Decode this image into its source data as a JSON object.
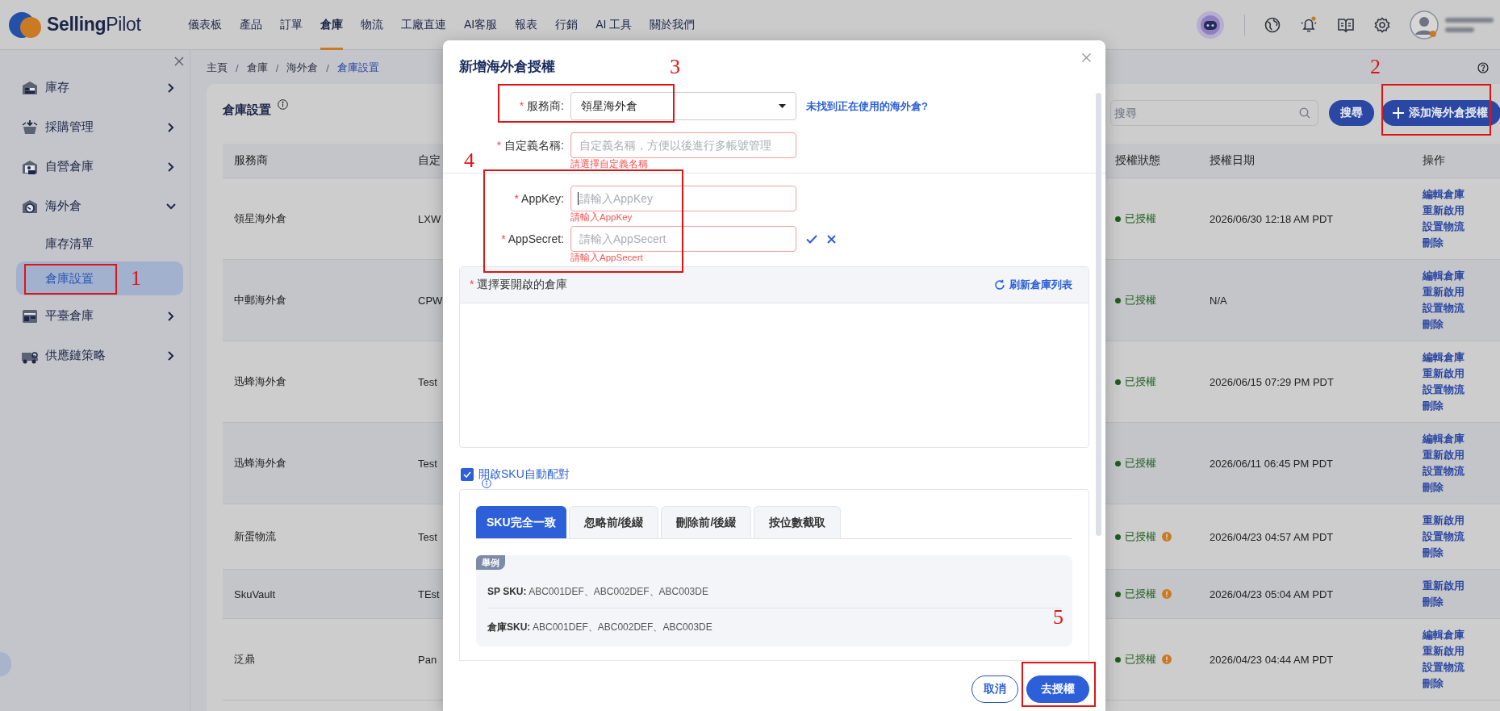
{
  "nav": {
    "logo": "**Selling**Pilot",
    "items": [
      {
        "label": "儀表板",
        "selected": false
      },
      {
        "label": "產品",
        "selected": false
      },
      {
        "label": "訂單",
        "selected": false
      },
      {
        "label": "倉庫",
        "selected": true
      },
      {
        "label": "物流",
        "selected": false
      },
      {
        "label": "工廠直連",
        "selected": false
      },
      {
        "label": "AI客服",
        "selected": false
      },
      {
        "label": "報表",
        "selected": false
      },
      {
        "label": "行銷",
        "selected": false
      },
      {
        "label": "AI 工具",
        "selected": false
      },
      {
        "label": "關於我們",
        "selected": false
      }
    ]
  },
  "sidebar": {
    "items": [
      {
        "label": "庫存",
        "expanded": false
      },
      {
        "label": "採購管理",
        "expanded": false
      },
      {
        "label": "自營倉庫",
        "expanded": false
      },
      {
        "label": "海外倉",
        "expanded": true,
        "children": [
          {
            "label": "庫存清單",
            "selected": false
          },
          {
            "label": "倉庫設置",
            "selected": true
          }
        ]
      },
      {
        "label": "平臺倉庫",
        "expanded": false
      },
      {
        "label": "供應鏈策略",
        "expanded": false
      }
    ]
  },
  "breadcrumb": [
    {
      "label": "主頁",
      "current": false
    },
    {
      "label": "倉庫",
      "current": false
    },
    {
      "label": "海外倉",
      "current": false
    },
    {
      "label": "倉庫設置",
      "current": true
    }
  ],
  "breadcrumb_separator": "/",
  "page": {
    "title": "倉庫設置",
    "search_placeholder": "搜尋",
    "search_button": "搜尋",
    "add_button": "添加海外倉授權"
  },
  "table": {
    "columns": [
      "服務商",
      "自定",
      "授權狀態",
      "授權日期",
      "操作"
    ],
    "rows": [
      {
        "provider": "領星海外倉",
        "name": "LXW",
        "status": "已授權",
        "warning": false,
        "date": "2026/06/30 12:18 AM PDT",
        "actions": [
          "編輯倉庫",
          "重新啟用",
          "設置物流",
          "刪除"
        ]
      },
      {
        "provider": "中郵海外倉",
        "name": "CPW",
        "status": "已授權",
        "warning": false,
        "date": "N/A",
        "actions": [
          "編輯倉庫",
          "重新啟用",
          "設置物流",
          "刪除"
        ]
      },
      {
        "provider": "迅蜂海外倉",
        "name": "Test",
        "status": "已授權",
        "warning": false,
        "date": "2026/06/15 07:29 PM PDT",
        "actions": [
          "編輯倉庫",
          "重新啟用",
          "設置物流",
          "刪除"
        ]
      },
      {
        "provider": "迅蜂海外倉",
        "name": "Test",
        "status": "已授權",
        "warning": false,
        "date": "2026/06/11 06:45 PM PDT",
        "actions": [
          "編輯倉庫",
          "重新啟用",
          "設置物流",
          "刪除"
        ]
      },
      {
        "provider": "新蛋物流",
        "name": "Test",
        "status": "已授權",
        "warning": true,
        "date": "2026/04/23 04:57 AM PDT",
        "actions": [
          "重新啟用",
          "設置物流",
          "刪除"
        ]
      },
      {
        "provider": "SkuVault",
        "name": "TEst",
        "status": "已授權",
        "warning": true,
        "date": "2026/04/23 05:04 AM PDT",
        "actions": [
          "重新啟用",
          "刪除"
        ]
      },
      {
        "provider": "泛鼎",
        "name": "Pan",
        "status": "已授權",
        "warning": true,
        "date": "2026/04/23 04:44 AM PDT",
        "actions": [
          "編輯倉庫",
          "重新啟用",
          "設置物流",
          "刪除"
        ]
      }
    ]
  },
  "dialog": {
    "title": "新增海外倉授權",
    "required_mark": "*",
    "field_groups": [
      [
        {
          "kind": "select",
          "label": "服務商:",
          "required": true,
          "value": "領星海外倉",
          "link": "未找到正在使用的海外倉?"
        },
        {
          "kind": "text",
          "label": "自定義名稱:",
          "required": true,
          "placeholder": "自定義名稱，方便以後進行多帳號管理",
          "error": "請選擇自定義名稱"
        }
      ],
      [
        {
          "kind": "text",
          "label": "AppKey:",
          "required": true,
          "placeholder": "請輸入AppKey",
          "error": "請輸入AppKey",
          "focused": true
        },
        {
          "kind": "text",
          "label": "AppSecret:",
          "required": true,
          "placeholder": "請輸入AppSecert",
          "error": "請輸入AppSecert",
          "confirm_actions": true
        }
      ]
    ],
    "warehouse_panel": {
      "label": "選擇要開啟的倉庫",
      "required": true,
      "refresh": "刷新倉庫列表"
    },
    "auto_match": {
      "label": "開啟SKU自動配對",
      "checked": true
    },
    "tabs": [
      {
        "label": "SKU完全一致",
        "selected": true
      },
      {
        "label": "忽略前/後綴",
        "selected": false
      },
      {
        "label": "刪除前/後綴",
        "selected": false
      },
      {
        "label": "按位數截取",
        "selected": false
      }
    ],
    "example": {
      "tag": "舉例",
      "lines": [
        "**SP SKU:** ABC001DEF、ABC002DEF、ABC003DE",
        "**倉庫SKU:** ABC001DEF、ABC002DEF、ABC003DE"
      ]
    },
    "buttons": [
      {
        "label": "取消",
        "kind": "secondary"
      },
      {
        "label": "去授權",
        "kind": "primary"
      }
    ]
  },
  "annotations": [
    {
      "label": "1"
    },
    {
      "label": "2"
    },
    {
      "label": "3"
    },
    {
      "label": "4"
    },
    {
      "label": "5"
    }
  ]
}
